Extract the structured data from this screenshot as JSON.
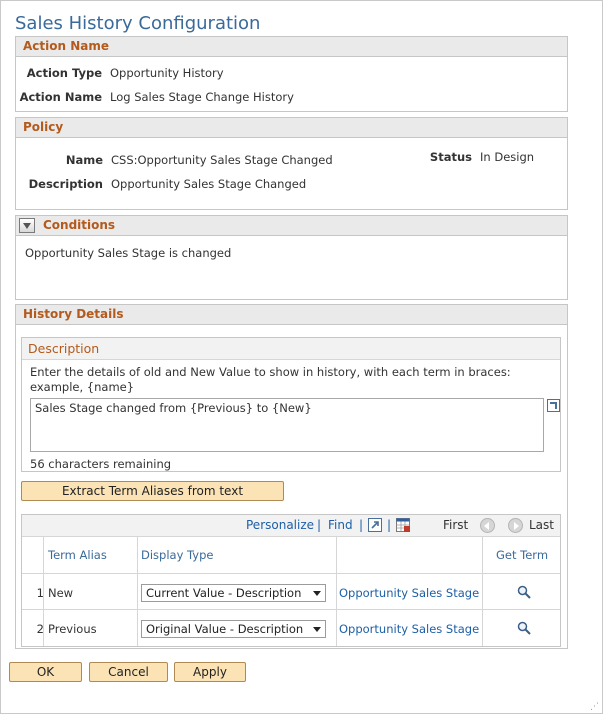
{
  "page": {
    "title": "Sales History Configuration"
  },
  "action_section": {
    "heading": "Action Name",
    "action_type_label": "Action Type",
    "action_type_value": "Opportunity History",
    "action_name_label": "Action Name",
    "action_name_value": "Log Sales Stage Change History"
  },
  "policy_section": {
    "heading": "Policy",
    "name_label": "Name",
    "name_value": "CSS:Opportunity Sales Stage Changed",
    "status_label": "Status",
    "status_value": "In Design",
    "description_label": "Description",
    "description_value": "Opportunity Sales Stage Changed"
  },
  "conditions_section": {
    "heading": "Conditions",
    "text": "Opportunity Sales Stage is changed"
  },
  "history_section": {
    "heading": "History Details",
    "description": {
      "heading": "Description",
      "instruction_line1": "Enter the details of old and New Value to show in history, with each term in braces:",
      "instruction_line2": "example, {name}",
      "value": "Sales Stage changed from {Previous} to {New}",
      "remaining": "56 characters remaining"
    },
    "extract_button": "Extract Term Aliases from text",
    "grid": {
      "personalize": "Personalize",
      "separator": "|",
      "find": "Find",
      "first": "First",
      "last": "Last",
      "columns": [
        "Term Alias",
        "Display Type",
        "Get Term"
      ],
      "rows": [
        {
          "num": "1",
          "alias": "New",
          "display_type": "Current Value - Description",
          "term": "Opportunity Sales Stage"
        },
        {
          "num": "2",
          "alias": "Previous",
          "display_type": "Original Value - Description",
          "term": "Opportunity Sales Stage"
        }
      ]
    }
  },
  "footer": {
    "ok": "OK",
    "cancel": "Cancel",
    "apply": "Apply"
  },
  "colors": {
    "section_heading": "#b35a1c",
    "link": "#1d5fa6",
    "button_bg": "#fbe3b6",
    "title": "#3a6a9a"
  },
  "icons": [
    "collapse-icon",
    "expand-textarea-icon",
    "zoom-icon",
    "download-icon",
    "first-arrow-icon",
    "next-arrow-icon",
    "lookup-icon"
  ]
}
